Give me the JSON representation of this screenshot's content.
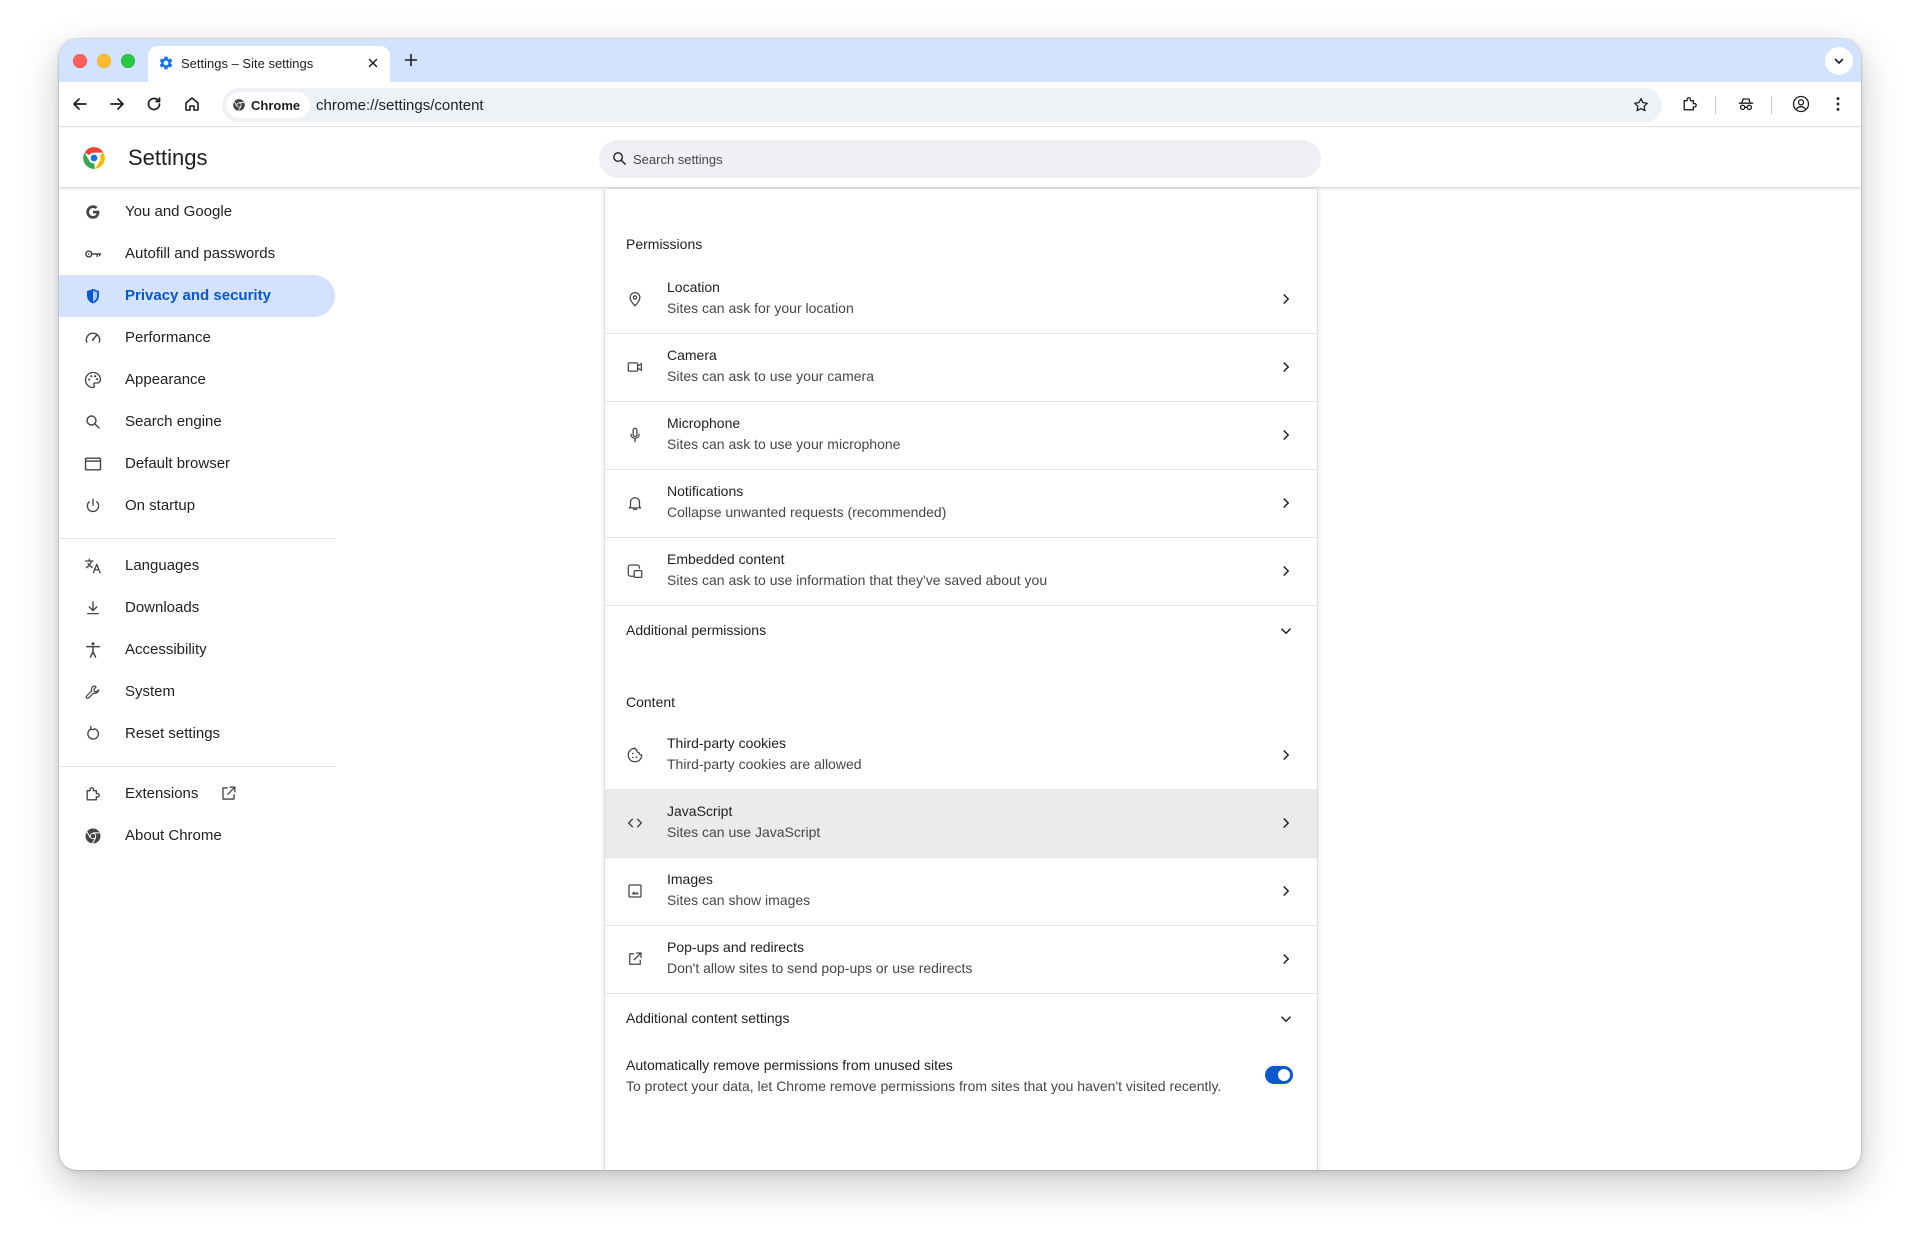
{
  "tab": {
    "title": "Settings – Site settings"
  },
  "omnibox": {
    "chip_label": "Chrome",
    "url": "chrome://settings/content"
  },
  "header": {
    "title": "Settings",
    "search_placeholder": "Search settings"
  },
  "sidebar": {
    "items": [
      {
        "label": "You and Google",
        "icon": "google-icon"
      },
      {
        "label": "Autofill and passwords",
        "icon": "key-icon"
      },
      {
        "label": "Privacy and security",
        "icon": "shield-icon",
        "active": true
      },
      {
        "label": "Performance",
        "icon": "speedometer-icon"
      },
      {
        "label": "Appearance",
        "icon": "palette-icon"
      },
      {
        "label": "Search engine",
        "icon": "search-icon"
      },
      {
        "label": "Default browser",
        "icon": "browser-window-icon"
      },
      {
        "label": "On startup",
        "icon": "power-icon"
      },
      {
        "label": "Languages",
        "icon": "translate-icon"
      },
      {
        "label": "Downloads",
        "icon": "download-icon"
      },
      {
        "label": "Accessibility",
        "icon": "accessibility-icon"
      },
      {
        "label": "System",
        "icon": "wrench-icon"
      },
      {
        "label": "Reset settings",
        "icon": "reset-icon"
      },
      {
        "label": "Extensions",
        "icon": "puzzle-icon"
      },
      {
        "label": "About Chrome",
        "icon": "chrome-icon"
      }
    ]
  },
  "main": {
    "permissions_title": "Permissions",
    "permissions": [
      {
        "title": "Location",
        "subtitle": "Sites can ask for your location",
        "icon": "location-pin-icon"
      },
      {
        "title": "Camera",
        "subtitle": "Sites can ask to use your camera",
        "icon": "camera-icon"
      },
      {
        "title": "Microphone",
        "subtitle": "Sites can ask to use your microphone",
        "icon": "microphone-icon"
      },
      {
        "title": "Notifications",
        "subtitle": "Collapse unwanted requests (recommended)",
        "icon": "bell-icon"
      },
      {
        "title": "Embedded content",
        "subtitle": "Sites can ask to use information that they've saved about you",
        "icon": "embedded-content-icon"
      }
    ],
    "additional_permissions": "Additional permissions",
    "content_title": "Content",
    "content": [
      {
        "title": "Third-party cookies",
        "subtitle": "Third-party cookies are allowed",
        "icon": "cookie-icon"
      },
      {
        "title": "JavaScript",
        "subtitle": "Sites can use JavaScript",
        "icon": "code-icon"
      },
      {
        "title": "Images",
        "subtitle": "Sites can show images",
        "icon": "image-icon"
      },
      {
        "title": "Pop-ups and redirects",
        "subtitle": "Don't allow sites to send pop-ups or use redirects",
        "icon": "open-in-new-icon"
      }
    ],
    "additional_content": "Additional content settings",
    "auto_remove": {
      "title": "Automatically remove permissions from unused sites",
      "subtitle": "To protect your data, let Chrome remove permissions from sites that you haven't visited recently.",
      "enabled": true
    }
  },
  "colors": {
    "accent": "#0b57d0",
    "tabstrip": "#d3e3fd",
    "active_nav": "#d3e3fd"
  }
}
